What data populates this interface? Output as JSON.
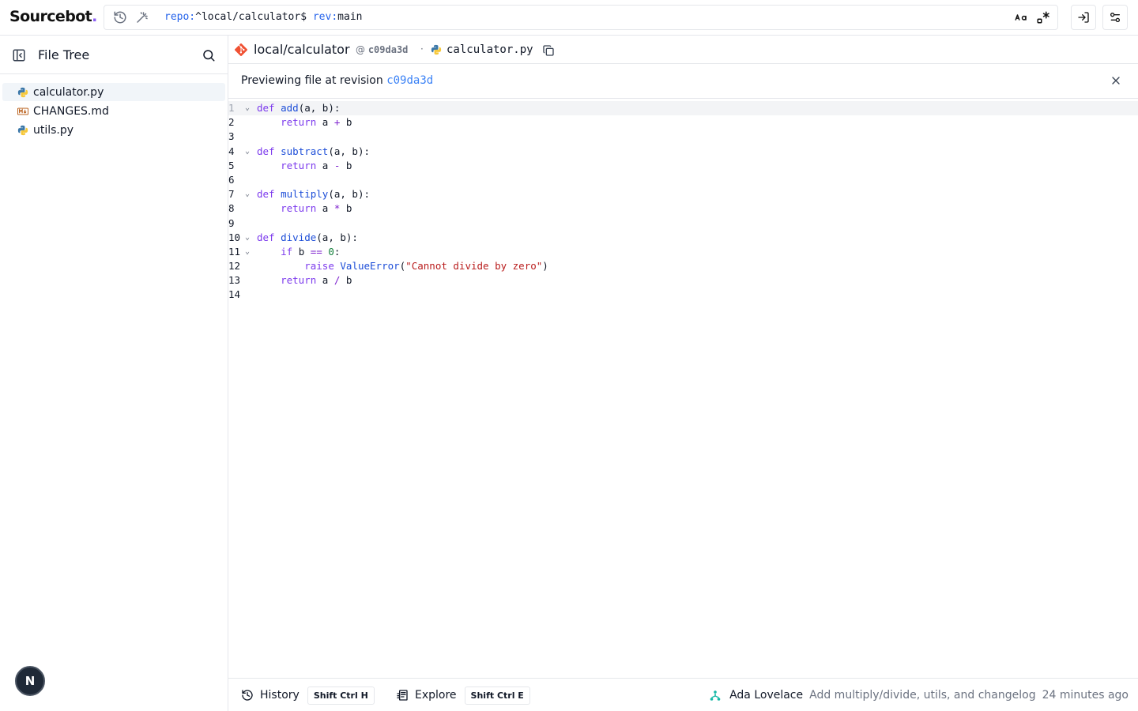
{
  "app": {
    "logo_main": "Source",
    "logo_accent": "bot",
    "logo_dot": "."
  },
  "search": {
    "repo_key": "repo:",
    "repo_value": "^local/calculator$",
    "rev_key": "rev:",
    "rev_value": "main"
  },
  "sidebar": {
    "title": "File Tree",
    "files": [
      {
        "name": "calculator.py",
        "icon": "python-icon",
        "active": true
      },
      {
        "name": "CHANGES.md",
        "icon": "markdown-icon",
        "active": false
      },
      {
        "name": "utils.py",
        "icon": "python-icon",
        "active": false
      }
    ],
    "avatar_initial": "N"
  },
  "path": {
    "repo": "local/calculator",
    "at": "@",
    "revision": "c09da3d",
    "separator": "·",
    "file": "calculator.py"
  },
  "preview": {
    "text": "Previewing file at revision",
    "revision": "c09da3d"
  },
  "code": {
    "lines": [
      {
        "n": "1"
      },
      {
        "n": "2"
      },
      {
        "n": "3"
      },
      {
        "n": "4"
      },
      {
        "n": "5"
      },
      {
        "n": "6"
      },
      {
        "n": "7"
      },
      {
        "n": "8"
      },
      {
        "n": "9"
      },
      {
        "n": "10"
      },
      {
        "n": "11"
      },
      {
        "n": "12"
      },
      {
        "n": "13"
      },
      {
        "n": "14"
      }
    ]
  },
  "bottom": {
    "history_label": "History",
    "history_kbd": "Shift Ctrl H",
    "explore_label": "Explore",
    "explore_kbd": "Shift Ctrl E",
    "author": "Ada Lovelace",
    "message": "Add multiply/divide, utils, and changelog",
    "time": "24 minutes ago"
  },
  "colors": {
    "accent": "#8b5cf6",
    "link": "#3b82f6",
    "git": "#f05133"
  }
}
